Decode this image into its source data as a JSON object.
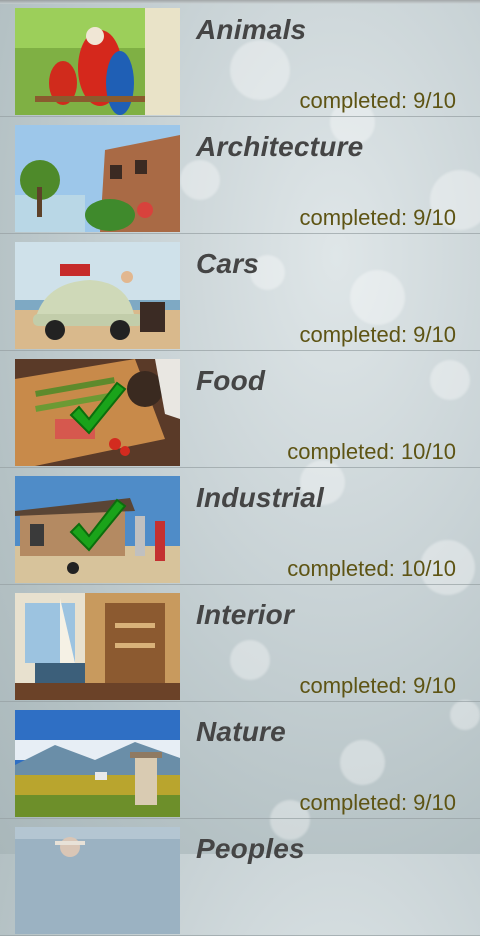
{
  "categories": [
    {
      "name": "Animals",
      "status": "completed: 9/10",
      "done": false,
      "thumb_icon": "parrots-photo"
    },
    {
      "name": "Architecture",
      "status": "completed: 9/10",
      "done": false,
      "thumb_icon": "village-photo"
    },
    {
      "name": "Cars",
      "status": "completed: 9/10",
      "done": false,
      "thumb_icon": "beetle-car-photo"
    },
    {
      "name": "Food",
      "status": "completed: 10/10",
      "done": true,
      "thumb_icon": "food-board-photo"
    },
    {
      "name": "Industrial",
      "status": "completed: 10/10",
      "done": true,
      "thumb_icon": "gas-station-photo"
    },
    {
      "name": "Interior",
      "status": "completed: 9/10",
      "done": false,
      "thumb_icon": "room-interior-photo"
    },
    {
      "name": "Nature",
      "status": "completed: 9/10",
      "done": false,
      "thumb_icon": "landscape-photo"
    },
    {
      "name": "Peoples",
      "status": "",
      "done": false,
      "thumb_icon": "people-photo"
    }
  ],
  "colors": {
    "title": "#454545",
    "status": "#5e5414",
    "check": "#1aa31a"
  }
}
